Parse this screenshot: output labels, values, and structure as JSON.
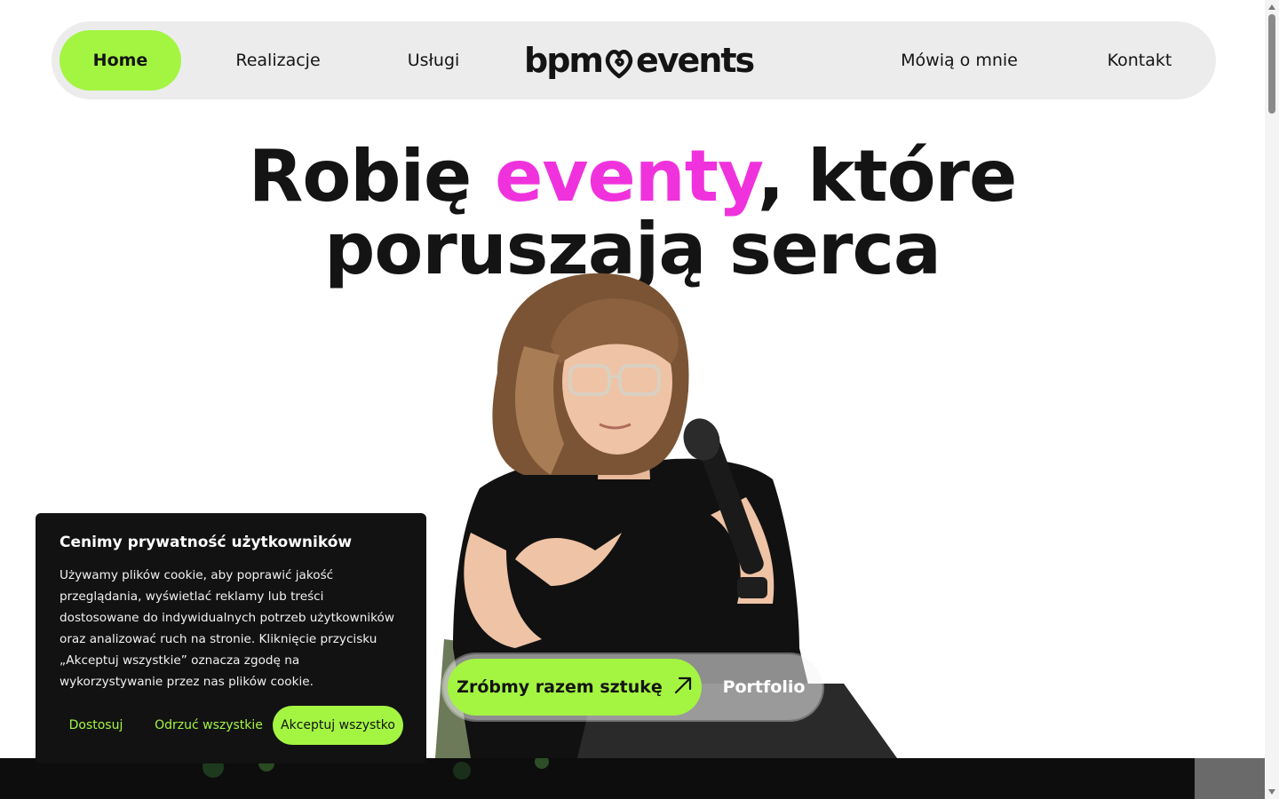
{
  "nav": {
    "items": [
      {
        "label": "Home",
        "active": true
      },
      {
        "label": "Realizacje"
      },
      {
        "label": "Usługi"
      },
      {
        "label": "Mówią o mnie"
      },
      {
        "label": "Kontakt"
      }
    ],
    "logo_left": "bpm",
    "logo_right": "events"
  },
  "hero": {
    "line1_before": "Robię ",
    "line1_accent": "eventy",
    "line1_after": ", które",
    "line2": "poruszają serca"
  },
  "cta": {
    "primary_label": "Zróbmy razem sztukę",
    "secondary_label": "Portfolio"
  },
  "cookie": {
    "title": "Cenimy prywatność użytkowników",
    "body": "Używamy plików cookie, aby poprawić jakość przeglądania, wyświetlać reklamy lub treści dostosowane do indywidualnych potrzeb użytkowników oraz analizować ruch na stronie. Kliknięcie przycisku „Akceptuj wszystkie” oznacza zgodę na wykorzystywanie przez nas plików cookie.",
    "customize_label": "Dostosuj",
    "reject_label": "Odrzuć wszystkie",
    "accept_label": "Akceptuj wszystko"
  },
  "colors": {
    "accent_green": "#a3f542",
    "accent_pink": "#f032dd",
    "nav_bg": "#ececec",
    "cookie_bg": "#121212"
  },
  "icons": {
    "cta_arrow": "arrow-up-right-icon",
    "logo_mark": "heart-swirl-icon"
  }
}
